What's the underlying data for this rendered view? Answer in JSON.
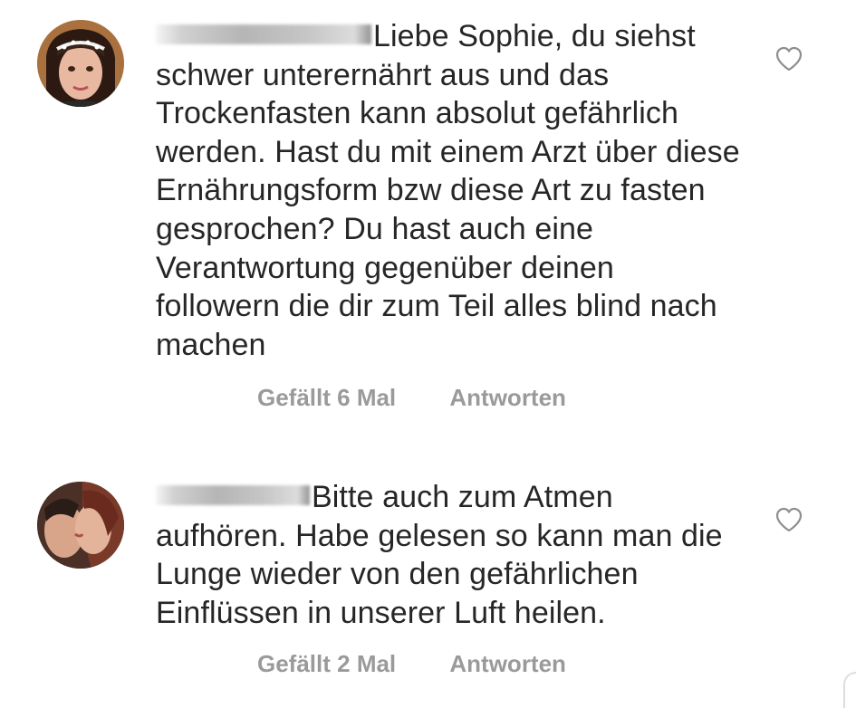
{
  "comments": [
    {
      "text": "Liebe Sophie, du siehst schwer unterernährt aus und das Trockenfasten kann absolut gefährlich werden. Hast du mit einem Arzt über diese Ernährungsform bzw diese Art zu fasten gesprochen? Du hast auch eine Verantwortung gegenüber deinen followern die dir zum Teil alles blind nach machen",
      "likes_label": "Gefällt 6 Mal",
      "reply_label": "Antworten",
      "like_icon": "heart-outline-icon"
    },
    {
      "text": "Bitte auch zum Atmen aufhören. Habe gelesen so kann man die Lunge wieder von den gefährlichen Einflüssen in unserer Luft heilen.",
      "likes_label": "Gefällt 2 Mal",
      "reply_label": "Antworten",
      "like_icon": "heart-outline-icon"
    }
  ],
  "colors": {
    "text": "#262626",
    "secondary": "#9a9a9a",
    "heart_stroke": "#8e8e8e"
  }
}
